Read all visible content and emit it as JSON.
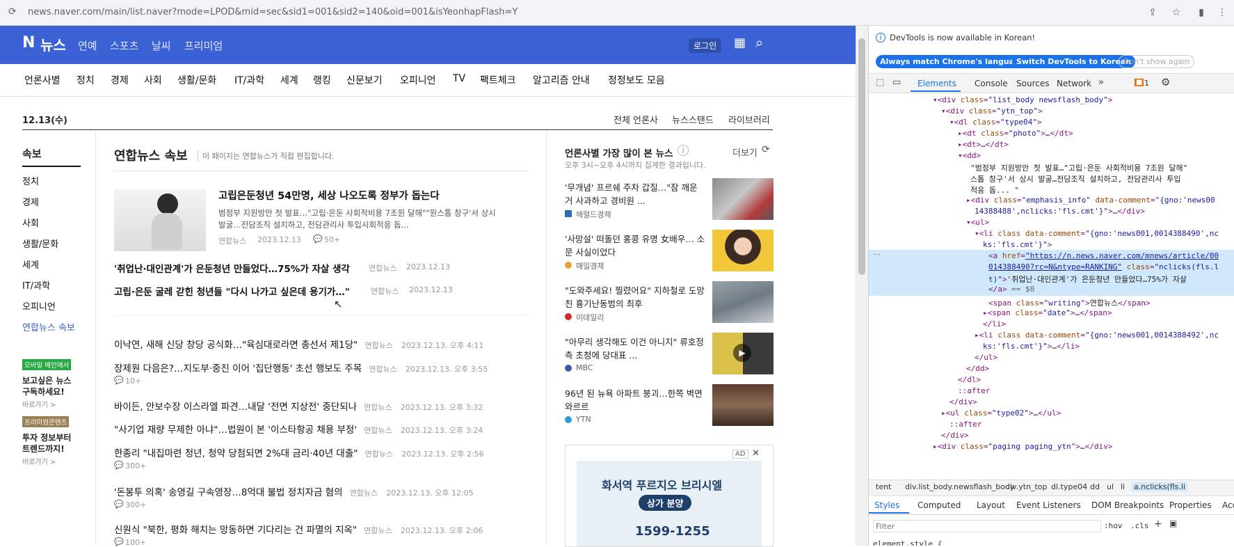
{
  "browser": {
    "url": "news.naver.com/main/list.naver?mode=LPOD&mid=sec&sid1=001&sid2=140&oid=001&isYeonhapFlash=Y"
  },
  "header": {
    "logo_n": "N",
    "logo_text": "뉴스",
    "nav": [
      "연예",
      "스포츠",
      "날씨",
      "프리미엄"
    ],
    "login": "로그인"
  },
  "gnb": [
    "언론사별",
    "정치",
    "경제",
    "사회",
    "생활/문화",
    "IT/과학",
    "세계",
    "랭킹",
    "신문보기",
    "오피니언",
    "TV",
    "팩트체크",
    "알고리즘 안내",
    "정정보도 모음"
  ],
  "date": "12.13(수)",
  "top_links": [
    "전체 언론사",
    "뉴스스탠드",
    "라이브러리"
  ],
  "sidebar": {
    "heading": "속보",
    "items": [
      "정치",
      "경제",
      "사회",
      "생활/문화",
      "세계",
      "IT/과학",
      "오피니언",
      "연합뉴스 속보"
    ],
    "promo1": {
      "badge": "모바일 메인에서",
      "title1": "보고싶은 뉴스",
      "title2": "구독하세요!",
      "link": "바로가기 >"
    },
    "promo2": {
      "badge": "프리미엄콘텐츠",
      "title1": "투자 정보부터",
      "title2": "트렌드까지!",
      "link": "바로가기 >"
    }
  },
  "main": {
    "title": "연합뉴스 속보",
    "subtitle": "이 페이지는 연합뉴스가 직접 편집합니다.",
    "headline": {
      "title": "고립은둔청년 54만명, 세상 나오도록 정부가 돕는다",
      "summary1": "범정부 지원방안 첫 발표…\"고립·은둔 사회적비용 7조원 달해\"\"원스톱 창구'서 상시",
      "summary2": "발굴…전담조직 설치하고, 전담관리사 투입사회적응 돕...",
      "press": "연합뉴스",
      "date": "2023.12.13",
      "comments": "50+"
    },
    "sub": [
      {
        "title": "'취업난·대인관계'가 은둔청년 만들었다…75%가 자살 생각",
        "press": "연합뉴스",
        "date": "2023.12.13"
      },
      {
        "title": "고립·은둔 굴레 갇힌 청년들 \"다시 나가고 싶은데 용기가…\"",
        "press": "연합뉴스",
        "date": "2023.12.13"
      }
    ],
    "list": [
      {
        "title": "이낙연, 새해 신당 창당 공식화…\"육심대로라면 총선서 제1당\"",
        "press": "연합뉴스",
        "date": "2023.12.13. 오후 4:11",
        "comments": ""
      },
      {
        "title": "장제원 다음은?…지도부·중진 이어 '집단행동' 초선 행보도 주목",
        "press": "연합뉴스",
        "date": "2023.12.13. 오후 3:55",
        "comments": "10+"
      },
      {
        "title": "바이든, 안보수장 이스라엘 파견…내달 '전면 지상전' 중단되나",
        "press": "연합뉴스",
        "date": "2023.12.13. 오후 3:32",
        "comments": ""
      },
      {
        "title": "\"사기업 재량 무제한 아냐\"…법원이 본 '이스타항공 채용 부정'",
        "press": "연합뉴스",
        "date": "2023.12.13. 오후 3:24",
        "comments": ""
      },
      {
        "title": "한종리 \"내집마련 청년, 청약 당첨되면 2%대 금리·40년 대출\"",
        "press": "연합뉴스",
        "date": "2023.12.13. 오후 2:56",
        "comments": "300+"
      },
      {
        "title": "'돈봉투 의혹' 송영길 구속영장…8억대 불법 정치자금 혐의",
        "press": "연합뉴스",
        "date": "2023.12.13. 오후 12:05",
        "comments": "300+"
      },
      {
        "title": "신원식 \"북한, 평화 해치는 망동하면 기다리는 건 파멸의 지옥\"",
        "press": "연합뉴스",
        "date": "2023.12.13. 오후 2:06",
        "comments": "100+"
      }
    ]
  },
  "ranking": {
    "title": "언론사별 가장 많이 본 뉴스",
    "more": "더보기",
    "subtitle": "오후 3시~오후 4시까지 집계한 결과입니다.",
    "items": [
      {
        "title": "'무개념' 프르쉐 주차 갑질…\"잠 깨운 거 사과하고 경비원 ...",
        "press": "헤럴드경제",
        "logo_color": "#2a6fb0"
      },
      {
        "title": "'사망설' 떠돌던 홍콩 유명 女배우… 소문 사실이었다",
        "press": "매일경제",
        "logo_color": "#e8a13a"
      },
      {
        "title": "\"도와주세요! 찔렸어요\" 지하철로 도망친 흉기난동범의 최후",
        "press": "이데일리",
        "logo_color": "#d62b2b"
      },
      {
        "title": "\"아무리 생각해도 이건 아니지\" 류호정 측 초청에 당대표 ...",
        "press": "MBC",
        "logo_color": "#3a5ba8"
      },
      {
        "title": "96년 된 뉴욕 아파트 붕괴…한쪽 벽면 와르르",
        "press": "YTN",
        "logo_color": "#2c9ad6"
      }
    ]
  },
  "ad": {
    "badge": "AD",
    "line1": "화서역 푸르지오 브리시엘",
    "line2": "상가 분양",
    "phone": "1599-1255"
  },
  "devtools": {
    "notice": "DevTools is now available in Korean!",
    "btn1": "Always match Chrome's language",
    "btn2": "Switch DevTools to Korean",
    "btn3": "Don't show again",
    "tabs": [
      "Elements",
      "Console",
      "Sources",
      "Network"
    ],
    "issues": "1",
    "crumbs": [
      "tent",
      "div.list_body.newsflash_body",
      "div.ytn_top",
      "dl.type04",
      "dd",
      "ul",
      "li",
      "a.nclicks(fls.li"
    ],
    "subtabs": [
      "Styles",
      "Computed",
      "Layout",
      "Event Listeners",
      "DOM Breakpoints",
      "Properties",
      "Access"
    ],
    "filter_placeholder": "Filter",
    "hov": ":hov",
    ".cls": ".cls",
    "element_style": "element.style {"
  }
}
